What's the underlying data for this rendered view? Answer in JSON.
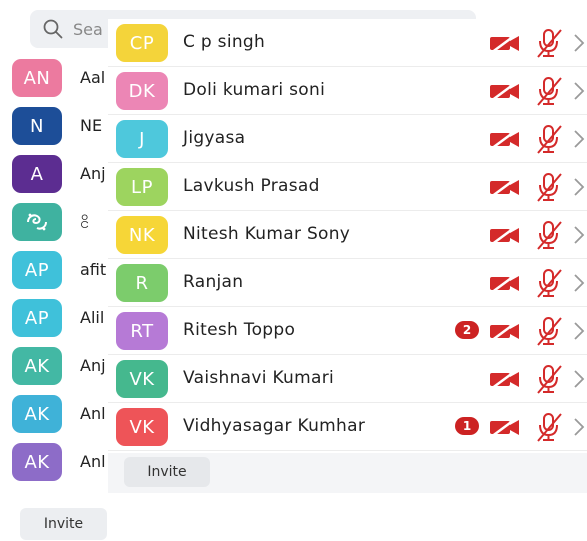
{
  "search": {
    "placeholder": "Sea"
  },
  "background_list": [
    {
      "initials": "AN",
      "name": "Aal",
      "color": "#ec7a9f"
    },
    {
      "initials": "N",
      "name": "NE",
      "color": "#1d4e98"
    },
    {
      "initials": "A",
      "name": "Anj",
      "color": "#5c2d91"
    },
    {
      "initials": "",
      "name": "ငိ",
      "color": "#3fb2a0",
      "image": "swirl-logo"
    },
    {
      "initials": "AP",
      "name": "afit",
      "color": "#3fc1da"
    },
    {
      "initials": "AP",
      "name": "Alil",
      "color": "#3fc1da"
    },
    {
      "initials": "AK",
      "name": "Anj",
      "color": "#43b8a4"
    },
    {
      "initials": "AK",
      "name": "Anl",
      "color": "#3fb2d8"
    },
    {
      "initials": "AK",
      "name": "Anl",
      "color": "#8d6cc8"
    }
  ],
  "background_invite_label": "Invite",
  "participants": [
    {
      "initials": "CP",
      "name": "C p singh",
      "color": "#f4d43a",
      "badge": "",
      "video_icon": "video-off-icon",
      "mic_icon": "mic-off-icon"
    },
    {
      "initials": "DK",
      "name": "Doli kumari soni",
      "color": "#ec86b5",
      "badge": "",
      "video_icon": "video-off-icon",
      "mic_icon": "mic-off-icon"
    },
    {
      "initials": "J",
      "name": "Jigyasa",
      "color": "#4ec8dc",
      "badge": "",
      "video_icon": "video-off-icon",
      "mic_icon": "mic-off-icon"
    },
    {
      "initials": "LP",
      "name": "Lavkush Prasad",
      "color": "#9dd45f",
      "badge": "",
      "video_icon": "video-off-icon",
      "mic_icon": "mic-off-icon"
    },
    {
      "initials": "NK",
      "name": "Nitesh Kumar Sony",
      "color": "#f6d637",
      "badge": "",
      "video_icon": "video-off-icon",
      "mic_icon": "mic-off-icon"
    },
    {
      "initials": "R",
      "name": "Ranjan",
      "color": "#7ccc6c",
      "badge": "",
      "video_icon": "video-off-icon",
      "mic_icon": "mic-off-icon"
    },
    {
      "initials": "RT",
      "name": "Ritesh Toppo",
      "color": "#b67ad6",
      "badge": "2",
      "video_icon": "video-off-icon",
      "mic_icon": "mic-off-icon"
    },
    {
      "initials": "VK",
      "name": "Vaishnavi Kumari",
      "color": "#45b88e",
      "badge": "",
      "video_icon": "video-off-icon",
      "mic_icon": "mic-off-icon"
    },
    {
      "initials": "VK",
      "name": "Vidhyasagar Kumhar",
      "color": "#ee5458",
      "badge": "1",
      "video_icon": "video-off-icon",
      "mic_icon": "mic-off-icon"
    }
  ],
  "invite_label": "Invite",
  "colors": {
    "muted_red": "#d42a2a",
    "badge_red": "#cc2222",
    "chevron": "#9a9a9a"
  }
}
